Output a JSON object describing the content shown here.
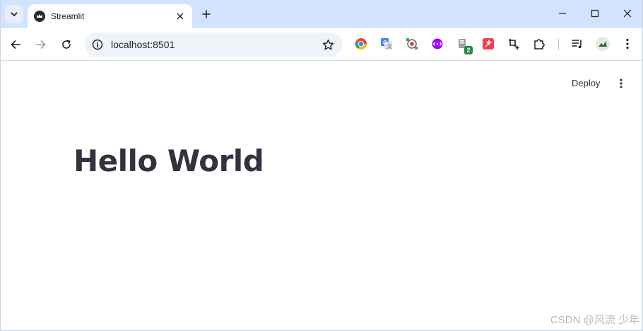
{
  "browser": {
    "tab": {
      "title": "Streamlit",
      "favicon": "streamlit-crown-icon"
    },
    "address_bar": {
      "url": "localhost:8501"
    },
    "extensions": [
      {
        "name": "chrome-circle-icon"
      },
      {
        "name": "google-translate-icon"
      },
      {
        "name": "screen-capture-icon"
      },
      {
        "name": "purple-extension-icon"
      },
      {
        "name": "green-badge-extension-icon",
        "badge": "2"
      },
      {
        "name": "red-star-extension-icon"
      },
      {
        "name": "crop-add-icon"
      },
      {
        "name": "puzzle-extensions-icon"
      }
    ]
  },
  "app": {
    "toolbar": {
      "deploy_label": "Deploy"
    },
    "title": "Hello World"
  },
  "watermark": "CSDN @风流 少年",
  "colors": {
    "tab_strip": "#d3e3fd",
    "text_dark": "#31333f",
    "omnibox": "#eef2f9"
  }
}
